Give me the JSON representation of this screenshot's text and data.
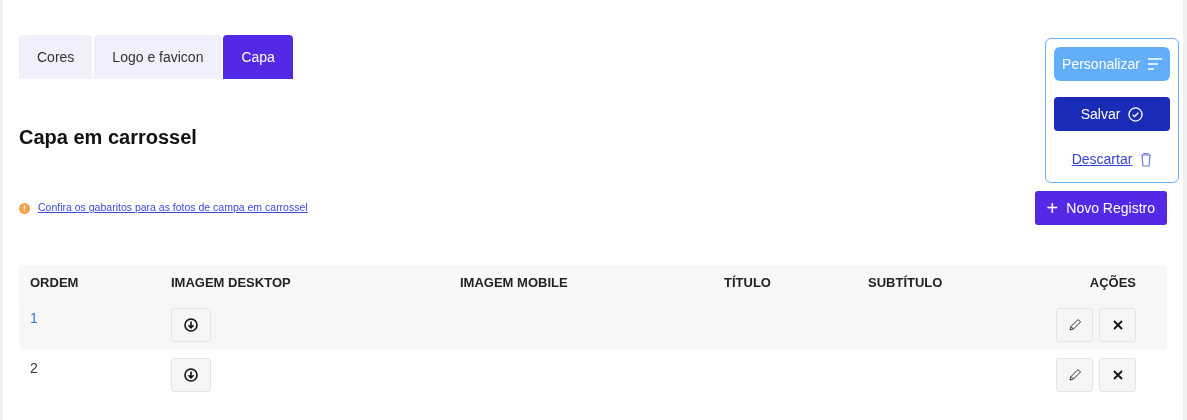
{
  "tabs": [
    {
      "label": "Cores",
      "selected": false
    },
    {
      "label": "Logo e favicon",
      "selected": false
    },
    {
      "label": "Capa",
      "selected": true
    }
  ],
  "heading": "Capa em carrossel",
  "notice": {
    "link": "Confira os gabaritos para as fotos de campa em carrossel"
  },
  "new_button": {
    "icon": "+",
    "label": "Novo Registro"
  },
  "panel": {
    "customize": "Personalizar",
    "save": "Salvar",
    "discard": "Descartar"
  },
  "table": {
    "columns": [
      "ORDEM",
      "IMAGEM DESKTOP",
      "IMAGEM MOBILE",
      "TÍTULO",
      "SUBTÍTULO",
      "AÇÕES"
    ],
    "rows": [
      {
        "order": "1",
        "highlighted": true
      },
      {
        "order": "2",
        "highlighted": false
      }
    ]
  }
}
